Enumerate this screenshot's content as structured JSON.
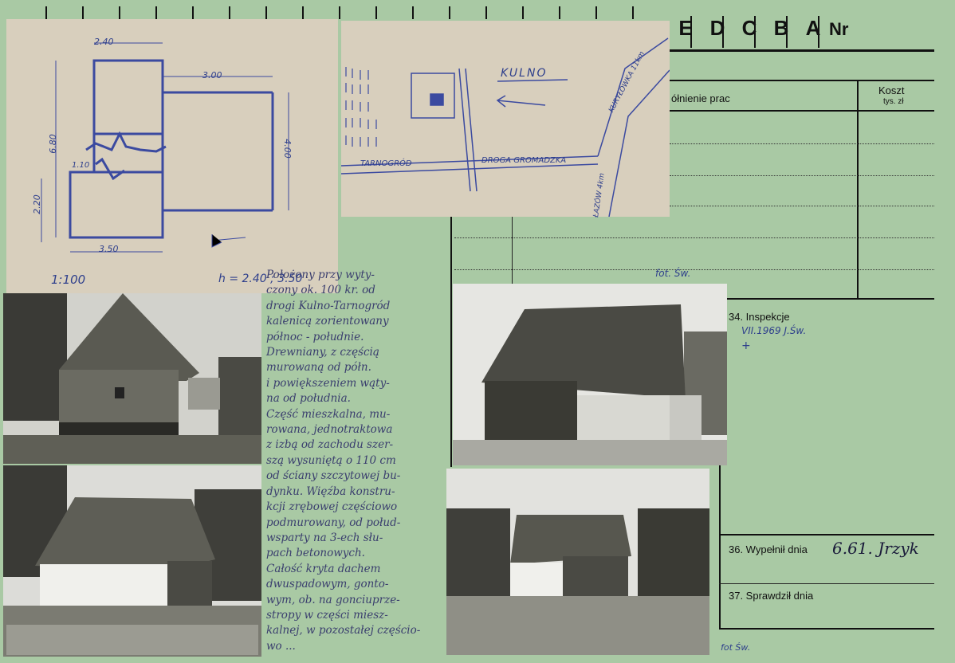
{
  "header": {
    "letters": [
      "E",
      "D",
      "C",
      "B",
      "A"
    ],
    "nr_label": "Nr"
  },
  "form": {
    "col_works": "ółnienie prac",
    "col_cost": "Koszt",
    "col_cost_unit": "tys. zł",
    "photo_credit_1": "fot. Św.",
    "section34": "34. Inspekcje",
    "inspection_entry": "VII.1969  J.Św.",
    "inspection_mark": "+",
    "section36": "36. Wypełnił dnia",
    "filled_value": "6.61. Jrzyk",
    "section37": "37. Sprawdził dnia",
    "photo_credit_2": "fot Św."
  },
  "floor_plan": {
    "dim_top": "2.40",
    "dim_right_top": "3.00",
    "dim_left": "6.80",
    "dim_right": "4.00",
    "dim_left_lower": "2.20",
    "dim_door": "1.10",
    "dim_bottom": "3.50",
    "scale": "1:100",
    "height": "h = 2.40 ; 3.50"
  },
  "site_map": {
    "village": "KULNO",
    "road_main": "DROGA GROMADZKA",
    "town_left": "TARNOGRÓD",
    "road_right_top": "KURYŁÓWKA 11km",
    "road_right_bottom": "ŁAZÓW 4km"
  },
  "handwritten_description": [
    "Położony przy wyty-",
    "czony ok. 100 kr. od",
    "drogi Kulno-Tarnogród",
    "kalenicą zorientowany",
    "północ - południe.",
    "Drewniany, z częścią",
    "murowaną od półn.",
    "i powiększeniem wąty-",
    "na od południa.",
    "Część mieszkalna, mu-",
    "rowana, jednotraktowa",
    "z izbą od zachodu szer-",
    "szą wysuniętą o 110 cm",
    "od ściany szczytowej bu-",
    "dynku. Więźba konstru-",
    "kcji zrębowej częściowo",
    "podmurowany, od połud-",
    "wsparty na 3-ech słu-",
    "pach betonowych.",
    "Całość kryta dachem",
    "dwuspadowym, gonto-",
    "wym, ob. na gonciuprze-",
    "stropy w części miesz-",
    "kalnej, w pozostałej częścio-",
    "wo ..."
  ],
  "photos": [
    {
      "name": "photo-barn-left"
    },
    {
      "name": "photo-barn-right"
    },
    {
      "name": "photo-house-left"
    },
    {
      "name": "photo-house-right"
    }
  ],
  "colors": {
    "card": "#a9c9a4",
    "paper": "#d8cfbd",
    "ink": "#2e3f8c"
  }
}
